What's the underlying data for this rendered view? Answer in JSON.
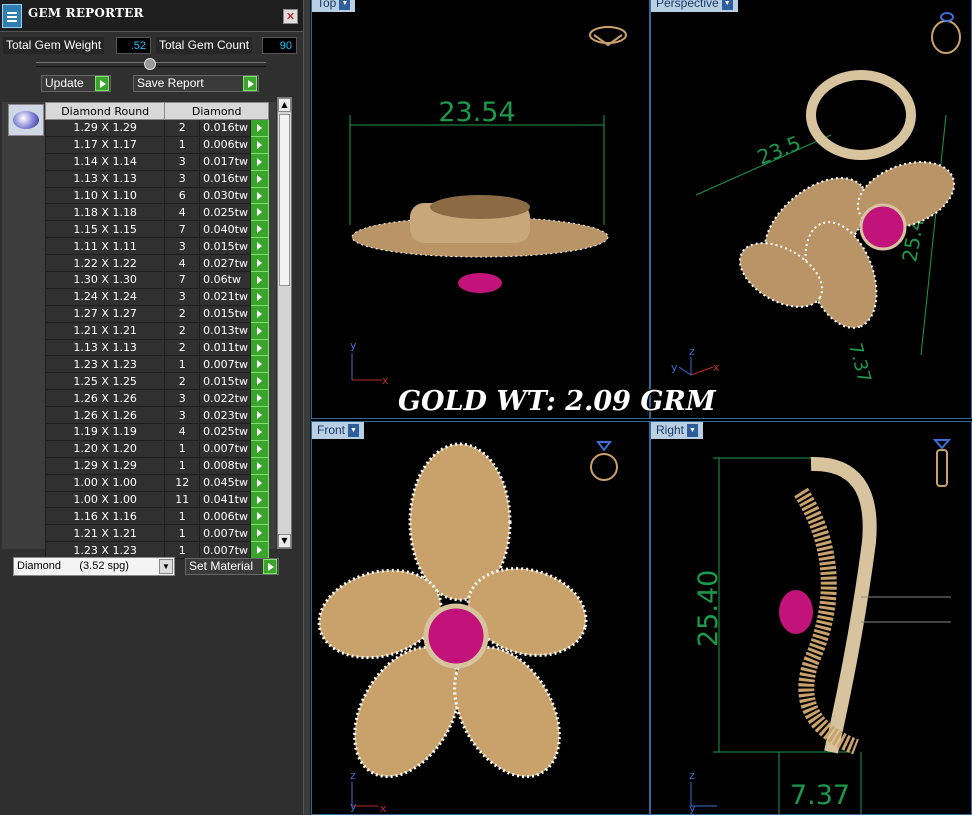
{
  "panel": {
    "title": "GEM REPORTER",
    "close_icon": "close-icon",
    "total_weight_label": "Total Gem Weight",
    "total_weight_value": ".52",
    "total_count_label": "Total Gem Count",
    "total_count_value": "90",
    "update_label": "Update",
    "save_report_label": "Save Report",
    "columns": [
      "Diamond Round",
      "Diamond"
    ],
    "rows": [
      {
        "size": "1.29 X 1.29",
        "count": "2",
        "weight": "0.016tw"
      },
      {
        "size": "1.17 X 1.17",
        "count": "1",
        "weight": "0.006tw"
      },
      {
        "size": "1.14 X 1.14",
        "count": "3",
        "weight": "0.017tw"
      },
      {
        "size": "1.13 X 1.13",
        "count": "3",
        "weight": "0.016tw"
      },
      {
        "size": "1.10 X 1.10",
        "count": "6",
        "weight": "0.030tw"
      },
      {
        "size": "1.18 X 1.18",
        "count": "4",
        "weight": "0.025tw"
      },
      {
        "size": "1.15 X 1.15",
        "count": "7",
        "weight": "0.040tw"
      },
      {
        "size": "1.11 X 1.11",
        "count": "3",
        "weight": "0.015tw"
      },
      {
        "size": "1.22 X 1.22",
        "count": "4",
        "weight": "0.027tw"
      },
      {
        "size": "1.30 X 1.30",
        "count": "7",
        "weight": "0.06tw"
      },
      {
        "size": "1.24 X 1.24",
        "count": "3",
        "weight": "0.021tw"
      },
      {
        "size": "1.27 X 1.27",
        "count": "2",
        "weight": "0.015tw"
      },
      {
        "size": "1.21 X 1.21",
        "count": "2",
        "weight": "0.013tw"
      },
      {
        "size": "1.13 X 1.13",
        "count": "2",
        "weight": "0.011tw"
      },
      {
        "size": "1.23 X 1.23",
        "count": "1",
        "weight": "0.007tw"
      },
      {
        "size": "1.25 X 1.25",
        "count": "2",
        "weight": "0.015tw"
      },
      {
        "size": "1.26 X 1.26",
        "count": "3",
        "weight": "0.022tw"
      },
      {
        "size": "1.26 X 1.26",
        "count": "3",
        "weight": "0.023tw"
      },
      {
        "size": "1.19 X 1.19",
        "count": "4",
        "weight": "0.025tw"
      },
      {
        "size": "1.20 X 1.20",
        "count": "1",
        "weight": "0.007tw"
      },
      {
        "size": "1.29 X 1.29",
        "count": "1",
        "weight": "0.008tw"
      },
      {
        "size": "1.00 X 1.00",
        "count": "12",
        "weight": "0.045tw"
      },
      {
        "size": "1.00 X 1.00",
        "count": "11",
        "weight": "0.041tw"
      },
      {
        "size": "1.16 X 1.16",
        "count": "1",
        "weight": "0.006tw"
      },
      {
        "size": "1.21 X 1.21",
        "count": "1",
        "weight": "0.007tw"
      },
      {
        "size": "1.23 X 1.23",
        "count": "1",
        "weight": "0.007tw"
      }
    ],
    "material_select": "Diamond      (3.52 spg)",
    "set_material_label": "Set Material"
  },
  "viewports": {
    "top": {
      "label": "Top",
      "dimension": "23.54"
    },
    "perspective": {
      "label": "Perspective",
      "dim_a": "23.5",
      "dim_b": "25.40",
      "dim_c": "7.37"
    },
    "front": {
      "label": "Front"
    },
    "right": {
      "label": "Right",
      "dim_height": "25.40",
      "dim_depth": "7.37"
    }
  },
  "overlay": {
    "gold_weight": "GOLD WT: 2.09 GRM"
  },
  "axes": {
    "x": "x",
    "y": "y",
    "z": "z"
  },
  "colors": {
    "dimension": "#1c9a4b",
    "gold": "#c9a26b",
    "ruby": "#c2137a",
    "viewport_border": "#2f6a9a"
  }
}
